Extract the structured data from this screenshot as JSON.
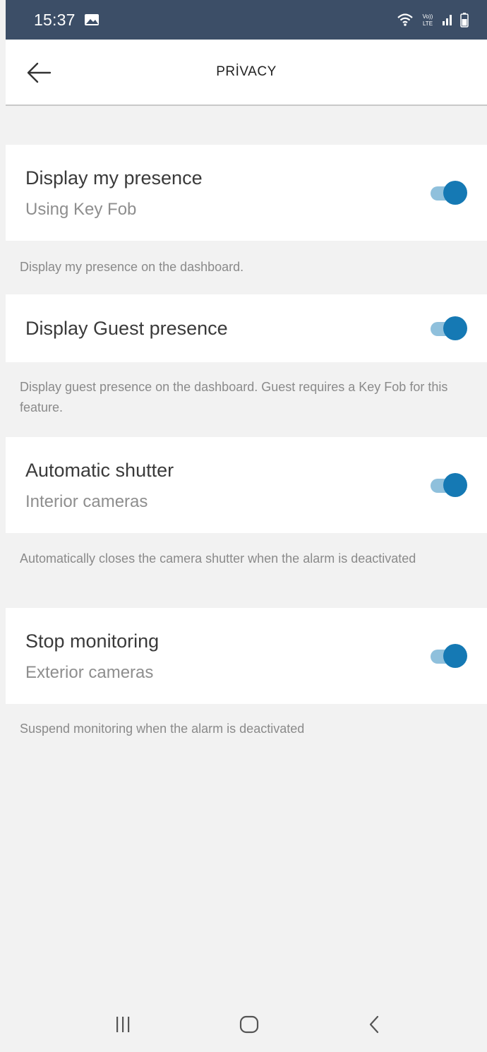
{
  "status_bar": {
    "time": "15:37",
    "icons": [
      "gallery-icon",
      "wifi-icon",
      "volte-icon",
      "signal-icon",
      "battery-icon"
    ],
    "volte_text": "VoLTE",
    "background_color": "#3c4e67"
  },
  "header": {
    "title": "PRİVACY",
    "back_icon": "arrow-left-icon"
  },
  "settings": [
    {
      "title": "Display my presence",
      "subtitle": "Using Key Fob",
      "enabled": true,
      "description": "Display my presence on the dashboard."
    },
    {
      "title": "Display Guest presence",
      "subtitle": "",
      "enabled": true,
      "description": "Display guest presence on the dashboard. Guest requires a Key Fob for this feature."
    },
    {
      "title": "Automatic shutter",
      "subtitle": "Interior cameras",
      "enabled": true,
      "description": "Automatically closes the camera shutter when the alarm is deactivated"
    },
    {
      "title": "Stop monitoring",
      "subtitle": "Exterior cameras",
      "enabled": true,
      "description": "Suspend monitoring when the alarm is deactivated"
    }
  ],
  "colors": {
    "accent": "#1579b4",
    "toggle_track": "#8fc0dc",
    "background": "#f2f2f2"
  },
  "nav_bar": {
    "buttons": [
      "recent-apps-icon",
      "home-icon",
      "back-icon"
    ]
  }
}
